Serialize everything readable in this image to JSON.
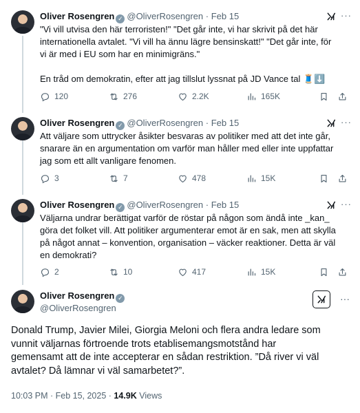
{
  "author": {
    "name": "Oliver Rosengren",
    "handle": "@OliverRosengren",
    "verified_icon": "verified-badge-icon"
  },
  "tweets": [
    {
      "date": "Feb 15",
      "lines": [
        "\"Vi vill utvisa den här terroristen!\" \"Det går inte, vi har skrivit på det här",
        "internationella avtalet. \"Vi vill ha ännu lägre bensinskatt!\" \"Det går inte, för",
        "vi är med i EU som har en minimigräns.\"",
        "",
        "En tråd om demokratin, efter att jag tillslut lyssnat på JD Vance tal 🧵⬇️"
      ],
      "stats": {
        "replies": "120",
        "reposts": "276",
        "likes": "2.2K",
        "views": "165K"
      }
    },
    {
      "date": "Feb 15",
      "lines": [
        "Att väljare som uttrycker åsikter besvaras av politiker med att det inte går,",
        "snarare än en argumentation om varför man håller med eller inte uppfattar",
        "jag som ett allt vanligare fenomen."
      ],
      "stats": {
        "replies": "3",
        "reposts": "7",
        "likes": "478",
        "views": "15K"
      }
    },
    {
      "date": "Feb 15",
      "lines": [
        "Väljarna undrar berättigat varför de röstar på någon som ändå inte _kan_",
        "göra det folket vill. Att politiker argumenterar emot är en sak, men att skylla",
        "på något annat – konvention, organisation – väcker reaktioner. Detta är väl",
        "en demokrati?"
      ],
      "stats": {
        "replies": "2",
        "reposts": "10",
        "likes": "417",
        "views": "15K"
      }
    }
  ],
  "main_tweet": {
    "lines": [
      "Donald Trump, Javier Milei, Giorgia Meloni och flera andra ledare som",
      "vunnit väljarnas förtroende trots etablisemangsmotstånd har",
      "gemensamt att de inte accepterar en sådan restriktion. ”Då river vi väl",
      "avtalet? Då lämnar vi väl samarbetet?”."
    ],
    "timestamp": "10:03 PM · Feb 15, 2025",
    "views_count": "14.9K",
    "views_label": "Views"
  },
  "ui": {
    "separator": "·",
    "more": "···",
    "colors": {
      "secondary_text": "#536471",
      "divider": "#eff3f4",
      "thread_line": "#cfd9de"
    }
  }
}
